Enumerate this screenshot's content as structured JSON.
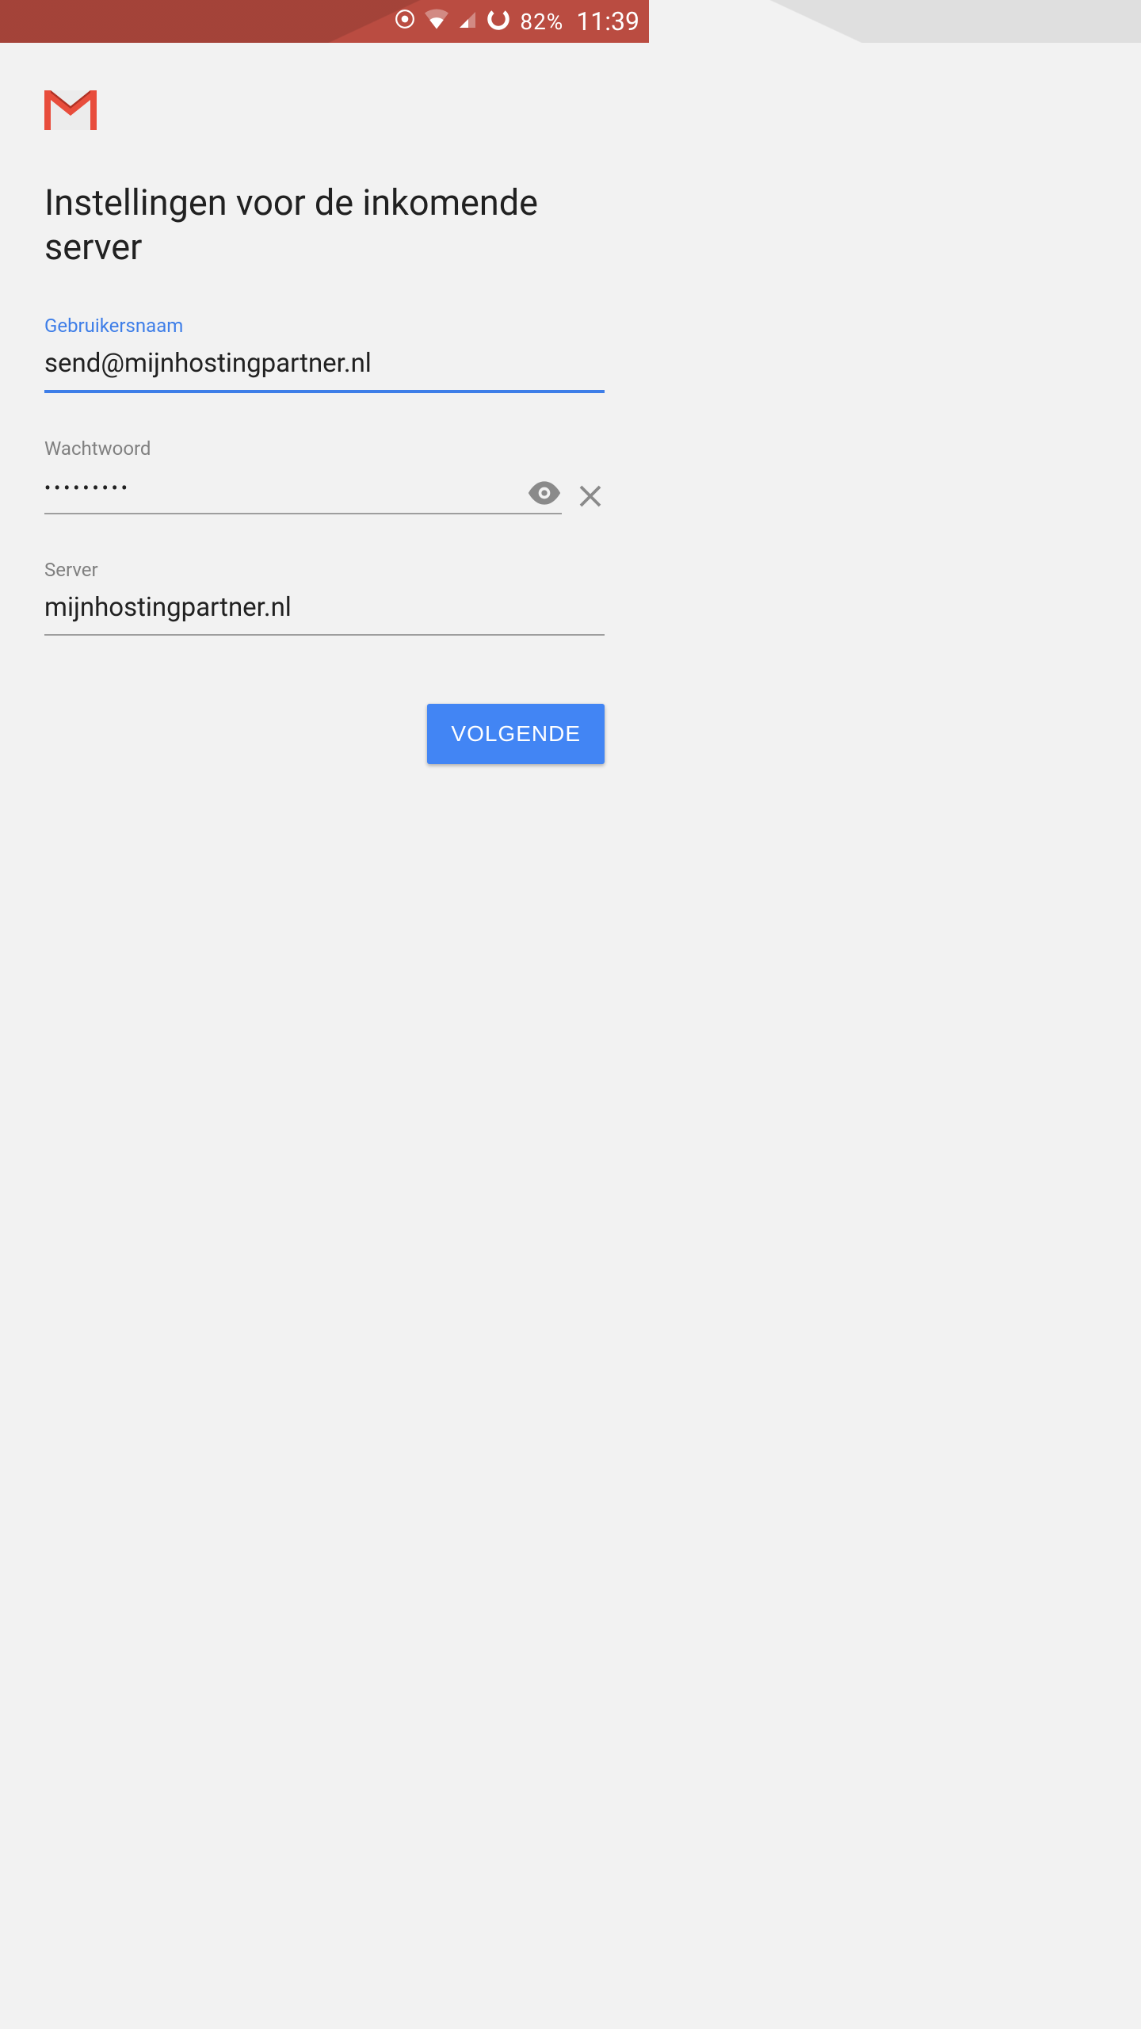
{
  "status": {
    "battery": "82%",
    "time": "11:39"
  },
  "page": {
    "title": "Instellingen voor de inkomende server",
    "username_label": "Gebruikersnaam",
    "username_value": "send@mijnhostingpartner.nl",
    "password_label": "Wachtwoord",
    "password_mask": "•••••••••",
    "server_label": "Server",
    "server_value": "mijnhostingpartner.nl",
    "next_label": "VOLGENDE"
  }
}
